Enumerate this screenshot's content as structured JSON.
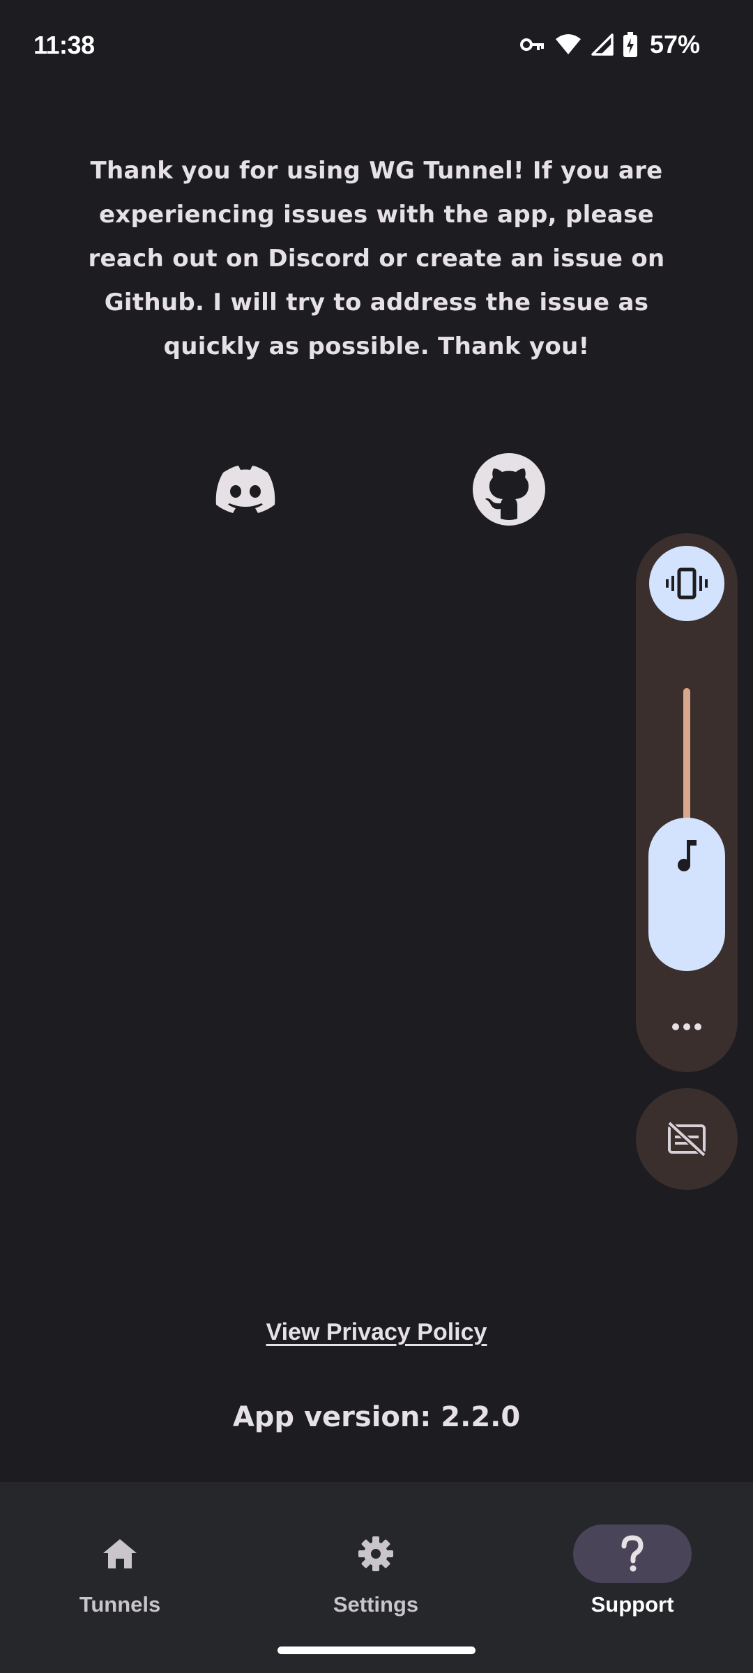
{
  "status_bar": {
    "time": "11:38",
    "battery_percent": "57%",
    "icons": [
      "vpn-key-icon",
      "wifi-icon",
      "cell-signal-icon",
      "battery-charging-icon"
    ]
  },
  "support": {
    "message": "Thank you for using WG Tunnel! If you are experiencing issues with the app, please reach out on Discord or create an issue on Github. I will try to address the issue as quickly as possible. Thank you!",
    "links": [
      "discord-icon",
      "github-icon"
    ]
  },
  "footer": {
    "privacy_link": "View Privacy Policy",
    "app_version": "App version: 2.2.0"
  },
  "volume_panel": {
    "ringer_mode_icon": "vibrate-icon",
    "stream_icon": "music-note-icon",
    "level": 0.5,
    "more_icon": "more-horiz-icon",
    "captions_icon": "captions-off-icon"
  },
  "bottom_nav": {
    "items": [
      {
        "label": "Tunnels",
        "icon": "home-icon",
        "active": false
      },
      {
        "label": "Settings",
        "icon": "gear-icon",
        "active": false
      },
      {
        "label": "Support",
        "icon": "question-mark-icon",
        "active": true
      }
    ]
  },
  "colors": {
    "background": "#1d1c20",
    "nav_background": "#25272b",
    "active_indicator": "#4a4458",
    "panel_background": "#3a2f2d",
    "panel_accent": "#d3e3fd",
    "slider_track": "#d9a78b"
  }
}
